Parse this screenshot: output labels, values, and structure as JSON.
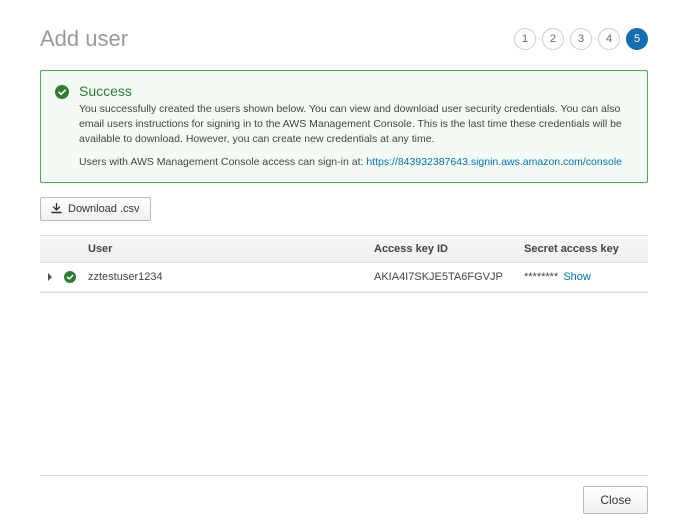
{
  "header": {
    "title": "Add user",
    "steps": [
      "1",
      "2",
      "3",
      "4",
      "5"
    ],
    "active_step_index": 4
  },
  "success": {
    "title": "Success",
    "body": "You successfully created the users shown below. You can view and download user security credentials. You can also email users instructions for signing in to the AWS Management Console. This is the last time these credentials will be available to download. However, you can create new credentials at any time.",
    "signin_prefix": "Users with AWS Management Console access can sign-in at: ",
    "signin_url": "https://843932387643.signin.aws.amazon.com/console"
  },
  "download_button_label": "Download .csv",
  "table": {
    "columns": {
      "user": "User",
      "access_key": "Access key ID",
      "secret": "Secret access key"
    },
    "rows": [
      {
        "user": "zztestuser1234",
        "access_key_id": "AKIA4I7SKJE5TA6FGVJP",
        "secret_mask": "********",
        "show_label": "Show"
      }
    ]
  },
  "footer": {
    "close_label": "Close"
  }
}
